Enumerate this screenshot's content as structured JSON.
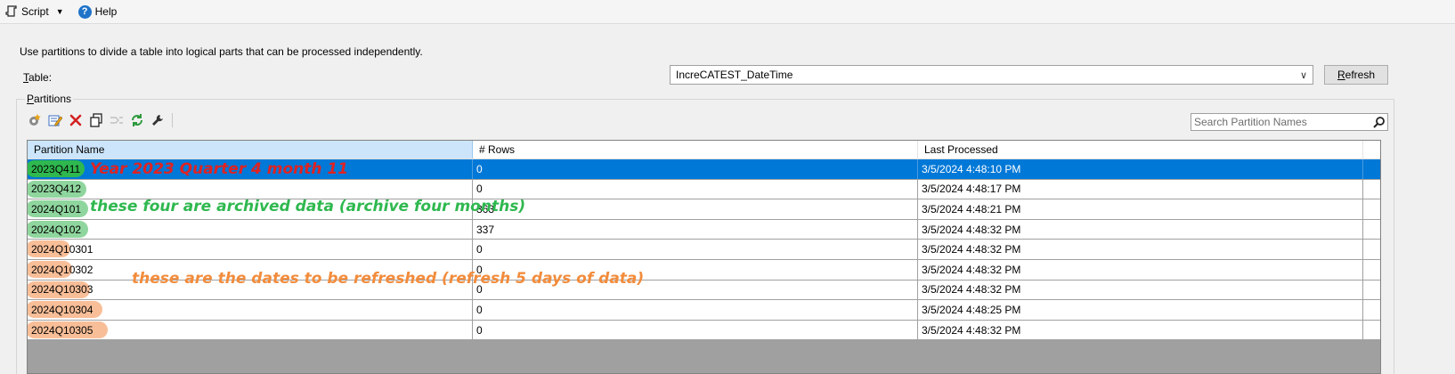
{
  "toolbar": {
    "script_label": "Script",
    "help_label": "Help",
    "icons": [
      "script-icon",
      "chevron-down-icon",
      "help-icon"
    ]
  },
  "description": "Use partitions to divide a table into logical parts that can be processed independently.",
  "table": {
    "label_first": "T",
    "label_rest": "able:",
    "selected": "IncreCATEST_DateTime",
    "refresh_first": "R",
    "refresh_rest": "efresh"
  },
  "partitions": {
    "group_first": "P",
    "group_rest": "artitions",
    "tools": [
      {
        "icon": "new-partition-icon",
        "enabled": true
      },
      {
        "icon": "edit-partition-icon",
        "enabled": true
      },
      {
        "icon": "delete-icon",
        "enabled": true
      },
      {
        "icon": "copy-icon",
        "enabled": true
      },
      {
        "icon": "merge-icon",
        "enabled": false
      },
      {
        "icon": "process-icon",
        "enabled": true
      },
      {
        "icon": "properties-wrench-icon",
        "enabled": true
      }
    ],
    "search_placeholder": "Search Partition Names",
    "columns": [
      "Partition Name",
      "# Rows",
      "Last Processed"
    ],
    "rows": [
      {
        "name": "2023Q411",
        "rows": "0",
        "last": "3/5/2024 4:48:10 PM",
        "selected": true,
        "hl": "#2fb84f"
      },
      {
        "name": "2023Q412",
        "rows": "0",
        "last": "3/5/2024 4:48:17 PM",
        "selected": false,
        "hl": "#8fd69e"
      },
      {
        "name": "2024Q101",
        "rows": "363",
        "last": "3/5/2024 4:48:21 PM",
        "selected": false,
        "hl": "#8fd69e"
      },
      {
        "name": "2024Q102",
        "rows": "337",
        "last": "3/5/2024 4:48:32 PM",
        "selected": false,
        "hl": "#8fd69e"
      },
      {
        "name": "2024Q10301",
        "rows": "0",
        "last": "3/5/2024 4:48:32 PM",
        "selected": false,
        "hl": "#f8be98"
      },
      {
        "name": "2024Q10302",
        "rows": "0",
        "last": "3/5/2024 4:48:32 PM",
        "selected": false,
        "hl": "#f8be98"
      },
      {
        "name": "2024Q10303",
        "rows": "0",
        "last": "3/5/2024 4:48:32 PM",
        "selected": false,
        "hl": "#f8be98"
      },
      {
        "name": "2024Q10304",
        "rows": "0",
        "last": "3/5/2024 4:48:25 PM",
        "selected": false,
        "hl": "#f8be98"
      },
      {
        "name": "2024Q10305",
        "rows": "0",
        "last": "3/5/2024 4:48:32 PM",
        "selected": false,
        "hl": "#f8be98"
      }
    ]
  },
  "annotations": {
    "red": "Year 2023 Quarter 4 month 11",
    "green": "these four are archived data (archive four months)",
    "orange": "these are the dates to be refreshed  (refresh 5 days of data)"
  },
  "colors": {
    "selection": "#0078d7",
    "annotation_red": "#e02222",
    "annotation_green": "#2fb84f",
    "annotation_orange": "#f28c3c"
  }
}
